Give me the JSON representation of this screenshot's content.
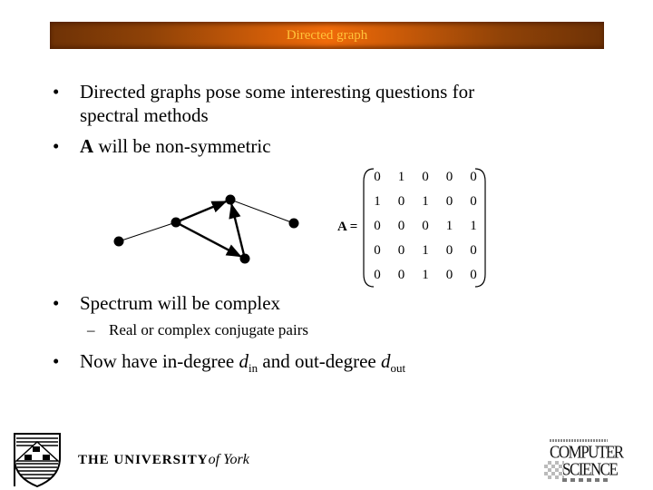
{
  "slide": {
    "title": "Directed graph",
    "bullets": [
      {
        "marker": "•",
        "line1": "Directed graphs pose some interesting questions for",
        "line2": "spectral methods"
      },
      {
        "marker": "•",
        "bold_part": "A",
        "rest": " will be non-symmetric"
      },
      {
        "marker": "•",
        "text": "Spectrum will be complex"
      },
      {
        "marker": "–",
        "text": "Real or complex conjugate pairs"
      },
      {
        "marker": "•",
        "prefix": "Now have in-degree ",
        "d1": "d",
        "sub1": "in",
        "middle": " and out-degree ",
        "d2": "d",
        "sub2": "out"
      }
    ],
    "matrix": {
      "label": "A =",
      "rows": [
        [
          "0",
          "1",
          "0",
          "0",
          "0"
        ],
        [
          "1",
          "0",
          "1",
          "0",
          "0"
        ],
        [
          "0",
          "0",
          "0",
          "1",
          "1"
        ],
        [
          "0",
          "0",
          "1",
          "0",
          "0"
        ],
        [
          "0",
          "0",
          "1",
          "0",
          "0"
        ]
      ]
    },
    "graph": {
      "nodes": [
        "n1",
        "n2",
        "n3",
        "n4",
        "n5"
      ],
      "edges": [
        {
          "from": "n1",
          "to": "n2",
          "directed": false
        },
        {
          "from": "n2",
          "to": "n3",
          "directed": true
        },
        {
          "from": "n2",
          "to": "n5",
          "directed": true
        },
        {
          "from": "n5",
          "to": "n3",
          "directed": true
        },
        {
          "from": "n3",
          "to": "n4",
          "directed": false
        }
      ]
    },
    "footer": {
      "university": "THE UNIVERSITY of York",
      "university_main": "THE UNIVERSITY",
      "university_script": "of York",
      "dept_top": "COMPUTER",
      "dept_bottom": "SCIENCE"
    }
  }
}
